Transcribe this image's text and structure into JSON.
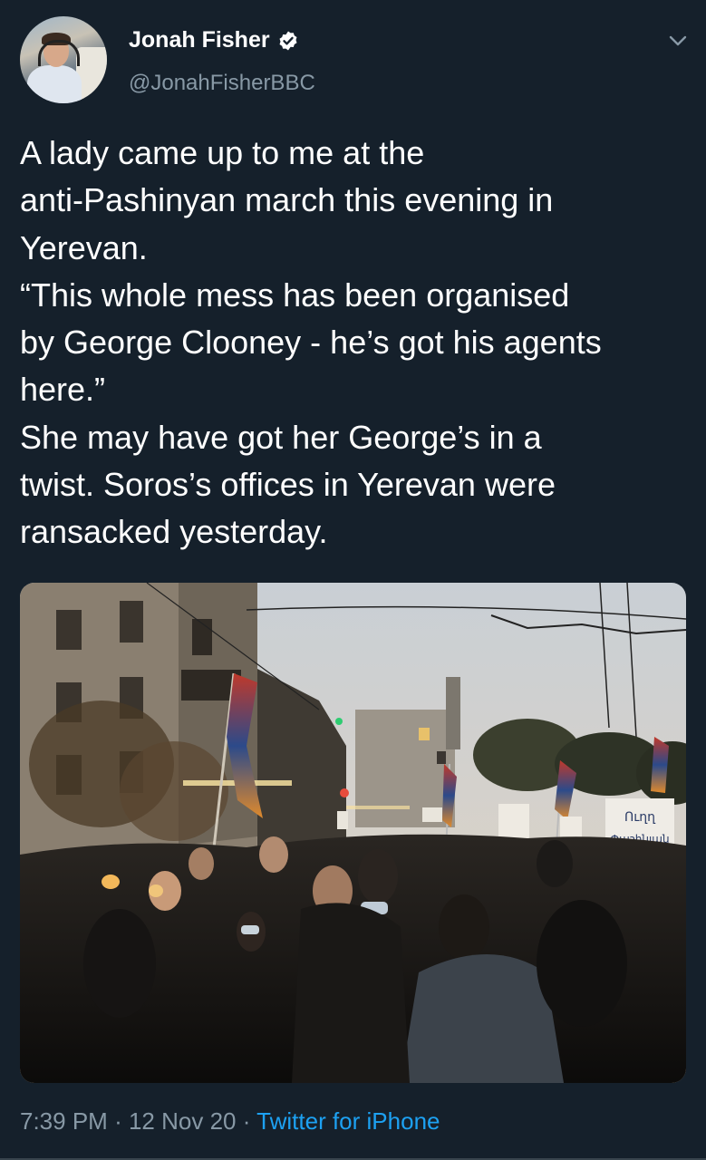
{
  "author": {
    "display_name": "Jonah Fisher",
    "handle": "@JonahFisherBBC",
    "verified": true,
    "avatar_icon": "profile-photo"
  },
  "tweet": {
    "text": "A lady came up to me at the\nanti-Pashinyan march this evening in\nYerevan.\n“This whole mess has been organised\nby George Clooney - he’s got his agents\nhere.”\nShe may have got her George’s in a\ntwist. Soros’s offices in Yerevan were\nransacked yesterday."
  },
  "media": {
    "sign_text": "Ուղղ\nՓաշինյան"
  },
  "meta": {
    "time": "7:39 PM",
    "separator": "·",
    "date": "12 Nov 20",
    "source": "Twitter for iPhone"
  },
  "colors": {
    "background": "#15202b",
    "primary_text": "#ffffff",
    "secondary_text": "#8899a6",
    "link": "#1da1f2"
  }
}
